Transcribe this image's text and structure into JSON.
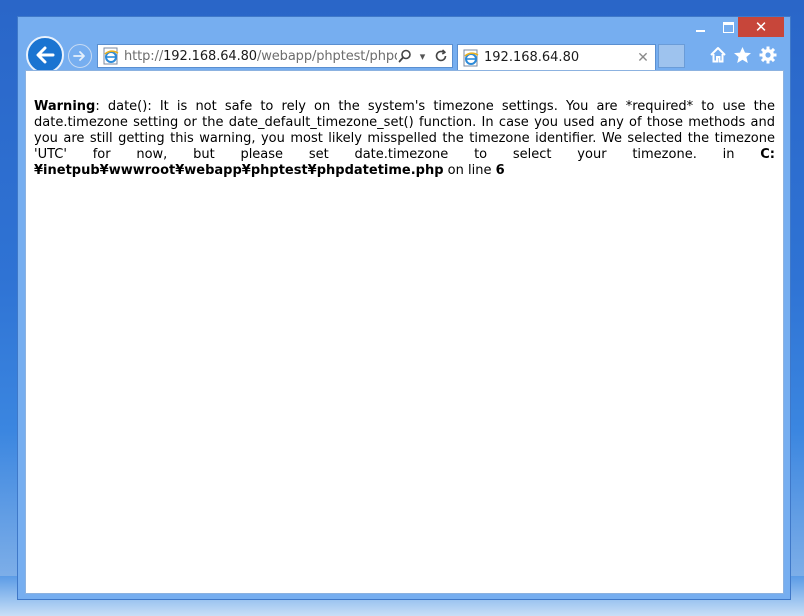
{
  "window": {
    "caption": {
      "minimize_icon": "minimize-icon",
      "maximize_icon": "maximize-icon",
      "close_glyph": "✕"
    }
  },
  "navigation": {
    "back_icon": "back-arrow-icon",
    "forward_icon": "forward-arrow-icon"
  },
  "address_bar": {
    "prefix": "http://",
    "host": "192.168.64.80",
    "path": "/webapp/phptest/phpdatet",
    "favicon": "ie-page-icon",
    "search_icon": "search-icon",
    "dropdown_glyph": "▾",
    "refresh_icon": "refresh-icon"
  },
  "tab": {
    "title": "192.168.64.80",
    "close_glyph": "✕"
  },
  "toolbar": {
    "home_icon": "home-icon",
    "favorites_icon": "star-icon",
    "settings_icon": "gear-icon"
  },
  "page": {
    "warning_label": "Warning",
    "message": ": date(): It is not safe to rely on the system's timezone settings. You are *required* to use the date.timezone setting or the date_default_timezone_set() function. In case you used any of those methods and you are still getting this warning, you most likely misspelled the timezone identifier. We selected the timezone 'UTC' for now, but please set date.timezone to select your timezone. in ",
    "file_path": "C:¥inetpub¥wwwroot¥webapp¥phptest¥phpdatetime.php",
    "on_line_text": " on line ",
    "line_number": "6"
  },
  "colors": {
    "accent": "#1a74d1",
    "close_button": "#c7463a",
    "frame": "#76aef0"
  }
}
